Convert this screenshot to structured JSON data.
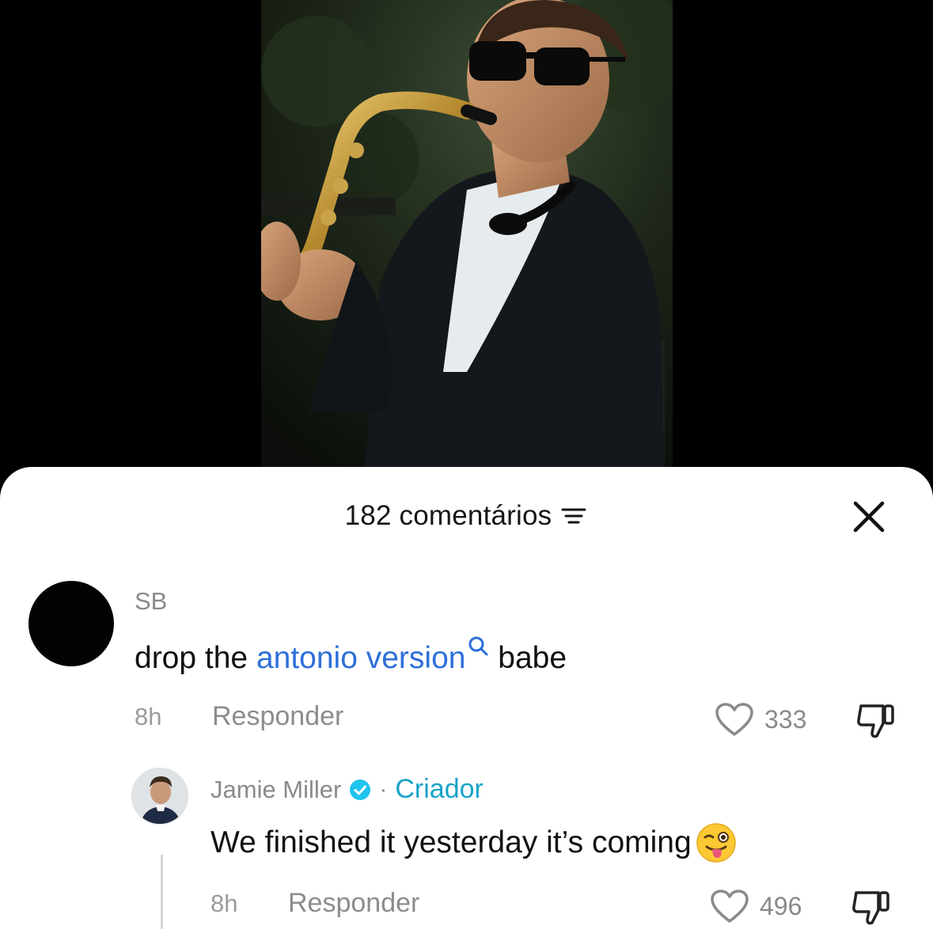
{
  "video": {
    "description_icon": "video-frame"
  },
  "comments_sheet": {
    "count_label": "182 comentários",
    "sort_icon": "sort-lines-icon",
    "close_icon": "close-icon"
  },
  "comments": [
    {
      "username": "SB",
      "text_before": "drop the ",
      "link_text": "antonio version",
      "text_after": " babe",
      "time": "8h",
      "reply_label": "Responder",
      "likes": "333"
    }
  ],
  "reply": {
    "username": "Jamie Miller",
    "separator": "·",
    "creator_label": "Criador",
    "text": "We finished it yesterday it’s coming",
    "emoji": "winking-face-with-tongue-icon",
    "time": "8h",
    "reply_label": "Responder",
    "likes": "496"
  },
  "colors": {
    "link": "#2d6fd8",
    "creator": "#1aa3c8",
    "verified": "#20c4ed"
  }
}
